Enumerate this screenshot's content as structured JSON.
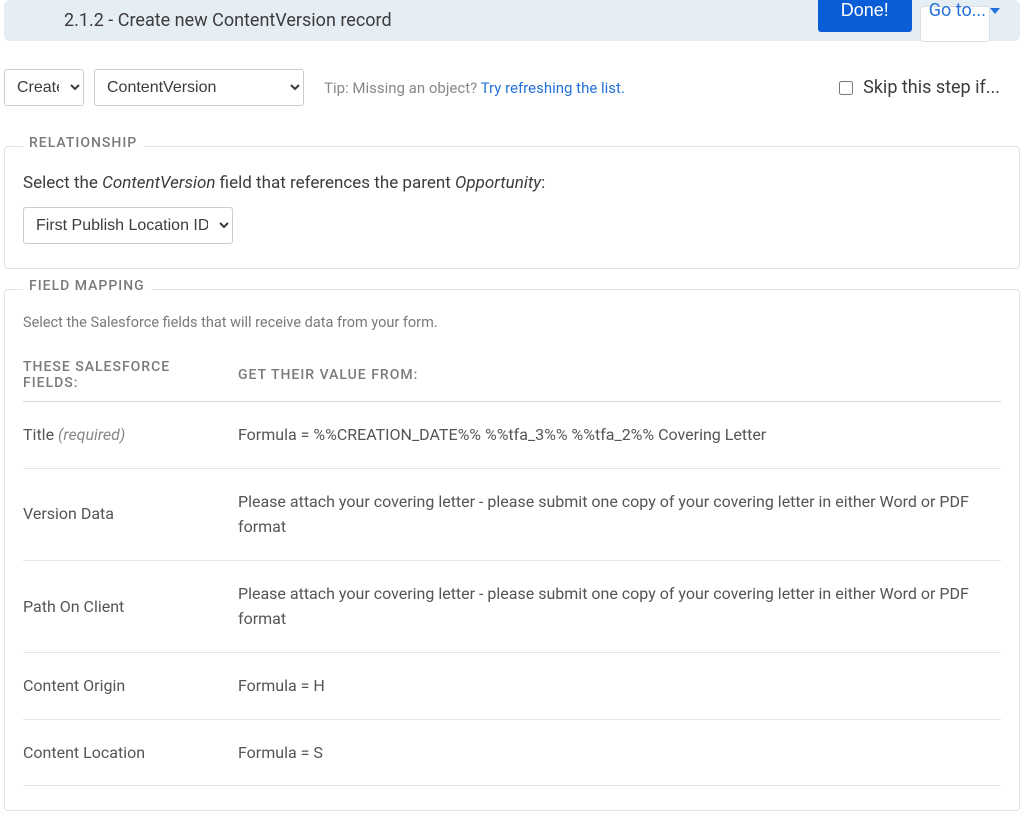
{
  "header": {
    "title": "2.1.2 - Create new ContentVersion record",
    "done_label": "Done!",
    "goto_label": "Go to..."
  },
  "controls": {
    "action_value": "Create",
    "object_value": "ContentVersion",
    "tip_prefix": "Tip: Missing an object? ",
    "tip_link": "Try refreshing the list.",
    "skip_label": "Skip this step if..."
  },
  "relationship": {
    "legend": "RELATIONSHIP",
    "lead": "Select the ",
    "field_entity": "ContentVersion",
    "mid": " field that references the parent ",
    "parent_entity": "Opportunity",
    "tail": ":",
    "selected_field": "First Publish Location ID"
  },
  "field_mapping": {
    "legend": "FIELD MAPPING",
    "description": "Select the Salesforce fields that will receive data from your form.",
    "col1": "THESE SALESFORCE FIELDS:",
    "col2": "GET THEIR VALUE FROM:",
    "rows": [
      {
        "field": "Title",
        "required": "(required)",
        "value": "Formula = %%CREATION_DATE%% %%tfa_3%% %%tfa_2%% Covering Letter"
      },
      {
        "field": "Version Data",
        "required": "",
        "value": "Please attach your covering letter - please submit one copy of your covering letter in either Word or PDF format"
      },
      {
        "field": "Path On Client",
        "required": "",
        "value": "Please attach your covering letter - please submit one copy of your covering letter in either Word or PDF format"
      },
      {
        "field": "Content Origin",
        "required": "",
        "value": "Formula = H"
      },
      {
        "field": "Content Location",
        "required": "",
        "value": "Formula = S"
      }
    ]
  }
}
